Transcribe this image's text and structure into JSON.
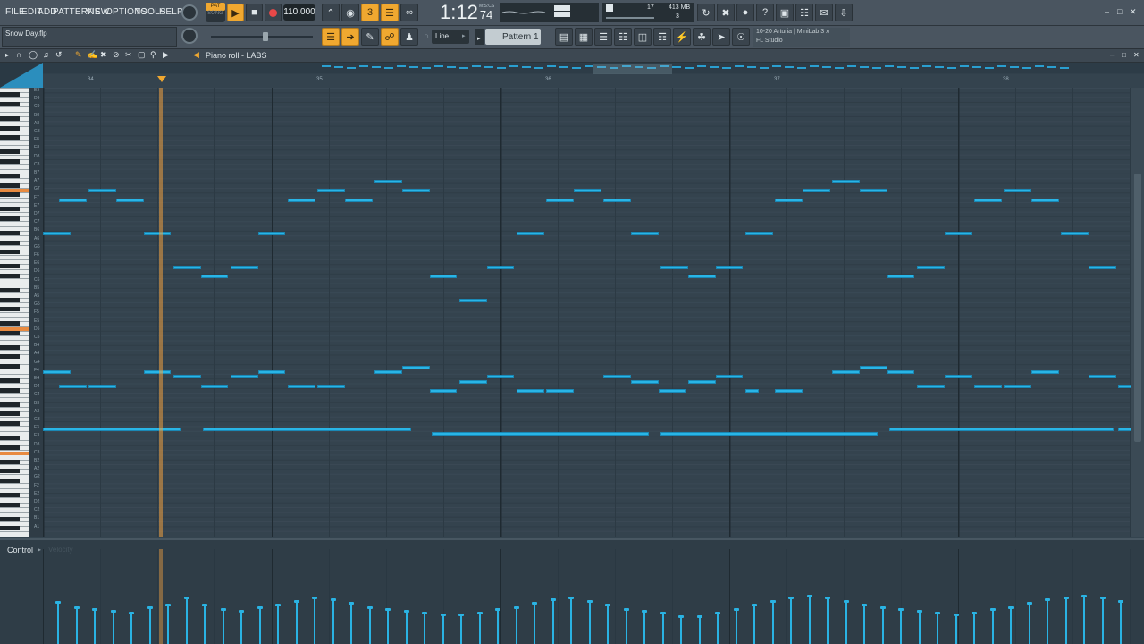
{
  "menu": [
    "FILE",
    "EDIT",
    "ADD",
    "PATTERNS",
    "VIEW",
    "OPTIONS",
    "TOOLS",
    "HELP"
  ],
  "transport": {
    "pat_label": "PAT",
    "song_label": "SONG",
    "tempo": "110.000",
    "time": "1:12",
    "time_sub": "74",
    "time_unit": "M:S:CS"
  },
  "sysinfo": {
    "voices": "17",
    "ram": "413 MB",
    "cores": "3"
  },
  "project_file": "Snow Day.flp",
  "snap_label": "Line",
  "pattern_label": "Pattern 1",
  "hint": {
    "line1": "10-20  Arturia | MiniLab 3 x",
    "line2": "FL Studio"
  },
  "piano_roll": {
    "title": "Piano roll - LABS"
  },
  "bars": [
    "34",
    "35",
    "36",
    "37",
    "38"
  ],
  "key_labels": [
    "E9",
    "D9",
    "C9",
    "B8",
    "A8",
    "G8",
    "F8",
    "E8",
    "D8",
    "C8",
    "B7",
    "A7",
    "G7",
    "F7",
    "E7",
    "D7",
    "C7",
    "B6",
    "A6",
    "G6",
    "F6",
    "E6",
    "D6",
    "C6",
    "B5",
    "A5",
    "G5",
    "F5",
    "E5",
    "D5",
    "C5",
    "B4",
    "A4",
    "G4",
    "F4",
    "E4",
    "D4",
    "C4",
    "B3",
    "A3",
    "G3",
    "F3",
    "E3",
    "D3",
    "C3",
    "B2",
    "A2",
    "G2",
    "F2",
    "E2",
    "D2",
    "C2",
    "B1",
    "A1"
  ],
  "control": {
    "label": "Control",
    "param": "Velocity"
  },
  "colors": {
    "note": "#29b5e6",
    "playhead": "#f0a040",
    "accent": "#f0a830"
  },
  "notes": [
    {
      "s": 0,
      "l": 0.12,
      "p": 20
    },
    {
      "s": 0.07,
      "l": 0.12,
      "p": 27
    },
    {
      "s": 0.2,
      "l": 0.12,
      "p": 29
    },
    {
      "s": 0.32,
      "l": 0.12,
      "p": 27
    },
    {
      "s": 0.44,
      "l": 0.12,
      "p": 20
    },
    {
      "s": 0.57,
      "l": 0.12,
      "p": 13
    },
    {
      "s": 0.69,
      "l": 0.12,
      "p": 11
    },
    {
      "s": 0.82,
      "l": 0.12,
      "p": 13
    },
    {
      "s": 0.94,
      "l": 0.12,
      "p": 20
    },
    {
      "s": 1.07,
      "l": 0.12,
      "p": 27
    },
    {
      "s": 1.2,
      "l": 0.12,
      "p": 29
    },
    {
      "s": 1.32,
      "l": 0.12,
      "p": 27
    },
    {
      "s": 1.45,
      "l": 0.12,
      "p": 31
    },
    {
      "s": 1.57,
      "l": 0.12,
      "p": 29
    },
    {
      "s": 1.69,
      "l": 0.12,
      "p": 11
    },
    {
      "s": 1.82,
      "l": 0.12,
      "p": 6
    },
    {
      "s": 1.94,
      "l": 0.12,
      "p": 13
    },
    {
      "s": 2.07,
      "l": 0.12,
      "p": 20
    },
    {
      "s": 2.2,
      "l": 0.12,
      "p": 27
    },
    {
      "s": 2.32,
      "l": 0.12,
      "p": 29
    },
    {
      "s": 2.45,
      "l": 0.12,
      "p": 27
    },
    {
      "s": 2.57,
      "l": 0.12,
      "p": 20
    },
    {
      "s": 2.7,
      "l": 0.12,
      "p": 13
    },
    {
      "s": 2.82,
      "l": 0.12,
      "p": 11
    },
    {
      "s": 2.94,
      "l": 0.12,
      "p": 13
    },
    {
      "s": 3.07,
      "l": 0.12,
      "p": 20
    },
    {
      "s": 3.2,
      "l": 0.12,
      "p": 27
    },
    {
      "s": 3.32,
      "l": 0.12,
      "p": 29
    },
    {
      "s": 3.45,
      "l": 0.12,
      "p": 31
    },
    {
      "s": 3.57,
      "l": 0.12,
      "p": 29
    },
    {
      "s": 3.69,
      "l": 0.12,
      "p": 11
    },
    {
      "s": 3.82,
      "l": 0.12,
      "p": 13
    },
    {
      "s": 3.94,
      "l": 0.12,
      "p": 20
    },
    {
      "s": 4.07,
      "l": 0.12,
      "p": 27
    },
    {
      "s": 4.2,
      "l": 0.12,
      "p": 29
    },
    {
      "s": 4.32,
      "l": 0.12,
      "p": 27
    },
    {
      "s": 4.45,
      "l": 0.12,
      "p": 20
    },
    {
      "s": 4.57,
      "l": 0.12,
      "p": 13
    },
    {
      "s": 0,
      "l": 0.12,
      "p": -9
    },
    {
      "s": 0.07,
      "l": 0.12,
      "p": -12
    },
    {
      "s": 0.2,
      "l": 0.12,
      "p": -12
    },
    {
      "s": 0.44,
      "l": 0.12,
      "p": -9
    },
    {
      "s": 0.57,
      "l": 0.12,
      "p": -10
    },
    {
      "s": 0.69,
      "l": 0.12,
      "p": -12
    },
    {
      "s": 0.82,
      "l": 0.12,
      "p": -10
    },
    {
      "s": 0.94,
      "l": 0.12,
      "p": -9
    },
    {
      "s": 1.07,
      "l": 0.12,
      "p": -12
    },
    {
      "s": 1.2,
      "l": 0.12,
      "p": -12
    },
    {
      "s": 1.45,
      "l": 0.12,
      "p": -9
    },
    {
      "s": 1.57,
      "l": 0.12,
      "p": -8
    },
    {
      "s": 1.69,
      "l": 0.12,
      "p": -13
    },
    {
      "s": 1.82,
      "l": 0.12,
      "p": -11
    },
    {
      "s": 1.94,
      "l": 0.12,
      "p": -10
    },
    {
      "s": 2.07,
      "l": 0.12,
      "p": -13
    },
    {
      "s": 2.2,
      "l": 0.12,
      "p": -13
    },
    {
      "s": 2.45,
      "l": 0.12,
      "p": -10
    },
    {
      "s": 2.57,
      "l": 0.12,
      "p": -11
    },
    {
      "s": 2.69,
      "l": 0.12,
      "p": -13
    },
    {
      "s": 2.82,
      "l": 0.12,
      "p": -11
    },
    {
      "s": 2.94,
      "l": 0.12,
      "p": -10
    },
    {
      "s": 3.07,
      "l": 0.06,
      "p": -13
    },
    {
      "s": 3.2,
      "l": 0.12,
      "p": -13
    },
    {
      "s": 3.45,
      "l": 0.12,
      "p": -9
    },
    {
      "s": 3.57,
      "l": 0.12,
      "p": -8
    },
    {
      "s": 3.69,
      "l": 0.12,
      "p": -9
    },
    {
      "s": 3.82,
      "l": 0.12,
      "p": -12
    },
    {
      "s": 3.94,
      "l": 0.12,
      "p": -10
    },
    {
      "s": 4.07,
      "l": 0.12,
      "p": -12
    },
    {
      "s": 4.2,
      "l": 0.12,
      "p": -12
    },
    {
      "s": 4.32,
      "l": 0.12,
      "p": -9
    },
    {
      "s": 4.57,
      "l": 0.12,
      "p": -10
    },
    {
      "s": 4.7,
      "l": 0.12,
      "p": -12
    },
    {
      "s": 0,
      "l": 0.6,
      "p": -21
    },
    {
      "s": 0.7,
      "l": 0.91,
      "p": -21
    },
    {
      "s": 1.7,
      "l": 0.95,
      "p": -22
    },
    {
      "s": 2.7,
      "l": 0.95,
      "p": -22
    },
    {
      "s": 3.7,
      "l": 0.98,
      "p": -21
    },
    {
      "s": 4.7,
      "l": 0.1,
      "p": -21
    }
  ],
  "velocities": [
    0.45,
    0.4,
    0.38,
    0.36,
    0.34,
    0.4,
    0.42,
    0.5,
    0.42,
    0.38,
    0.36,
    0.4,
    0.42,
    0.46,
    0.5,
    0.48,
    0.44,
    0.4,
    0.38,
    0.36,
    0.34,
    0.32,
    0.32,
    0.34,
    0.38,
    0.4,
    0.44,
    0.48,
    0.5,
    0.46,
    0.42,
    0.38,
    0.36,
    0.34,
    0.3,
    0.3,
    0.34,
    0.38,
    0.42,
    0.46,
    0.5,
    0.52,
    0.5,
    0.46,
    0.42,
    0.4,
    0.38,
    0.36,
    0.34,
    0.32,
    0.34,
    0.38,
    0.4,
    0.44,
    0.48,
    0.5,
    0.52,
    0.5,
    0.46
  ]
}
